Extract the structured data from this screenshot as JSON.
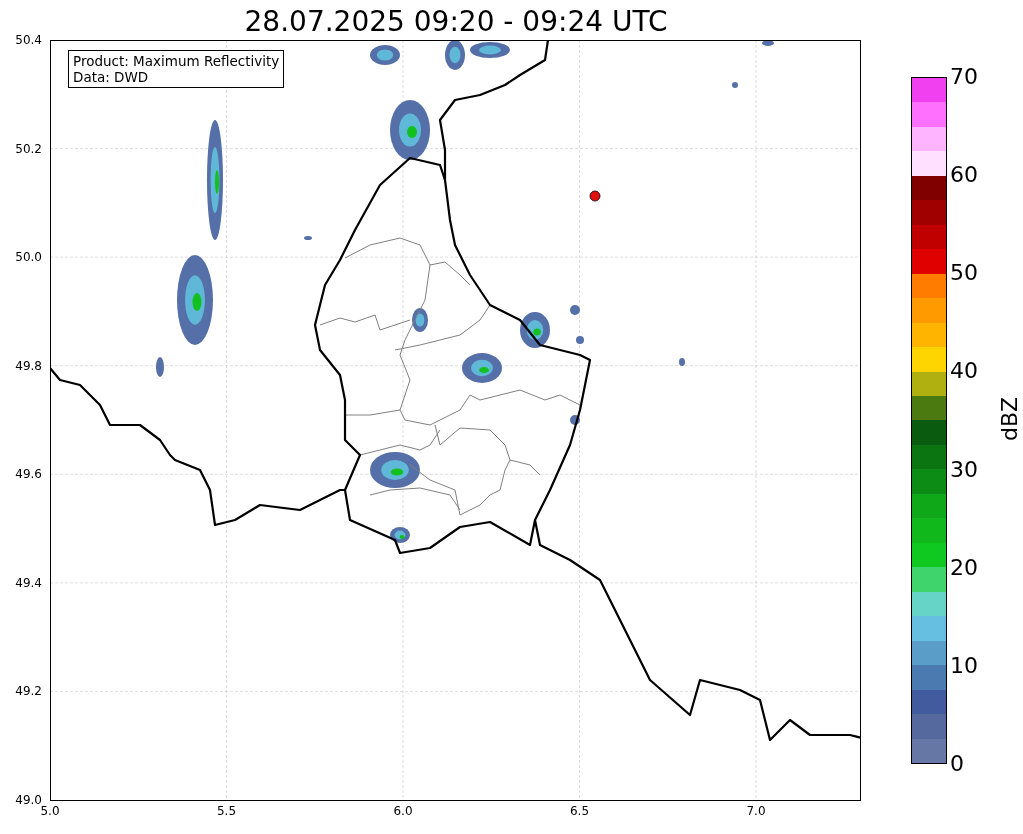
{
  "title": "28.07.2025 09:20 - 09:24 UTC",
  "info_box": [
    "Product: Maximum Reflectivity",
    "Data: DWD"
  ],
  "x_axis": {
    "ticks": [
      "5.0",
      "5.5",
      "6.0",
      "6.5",
      "7.0"
    ]
  },
  "y_axis": {
    "ticks": [
      "50.4",
      "50.2",
      "50.0",
      "49.8",
      "49.6",
      "49.4",
      "49.2",
      "49.0"
    ]
  },
  "colorbar": {
    "label": "dBZ",
    "ticks": [
      "70",
      "60",
      "50",
      "40",
      "30",
      "20",
      "10",
      "0"
    ],
    "segments": [
      {
        "color": "#6677a6"
      },
      {
        "color": "#55699f"
      },
      {
        "color": "#425b9e"
      },
      {
        "color": "#4b7ab0"
      },
      {
        "color": "#5a9dc8"
      },
      {
        "color": "#66bee0"
      },
      {
        "color": "#66d5c8"
      },
      {
        "color": "#3fd46c"
      },
      {
        "color": "#10c920"
      },
      {
        "color": "#10b81c"
      },
      {
        "color": "#0fa818"
      },
      {
        "color": "#0c8c14"
      },
      {
        "color": "#0b7512"
      },
      {
        "color": "#0a5a10"
      },
      {
        "color": "#4a7a10"
      },
      {
        "color": "#b0b010"
      },
      {
        "color": "#ffd500"
      },
      {
        "color": "#ffb400"
      },
      {
        "color": "#ff9a00"
      },
      {
        "color": "#ff7c00"
      },
      {
        "color": "#e00000"
      },
      {
        "color": "#c00000"
      },
      {
        "color": "#a00000"
      },
      {
        "color": "#800000"
      },
      {
        "color": "#ffe0ff"
      },
      {
        "color": "#ffb4ff"
      },
      {
        "color": "#ff70ff"
      },
      {
        "color": "#f040f0"
      }
    ]
  }
}
